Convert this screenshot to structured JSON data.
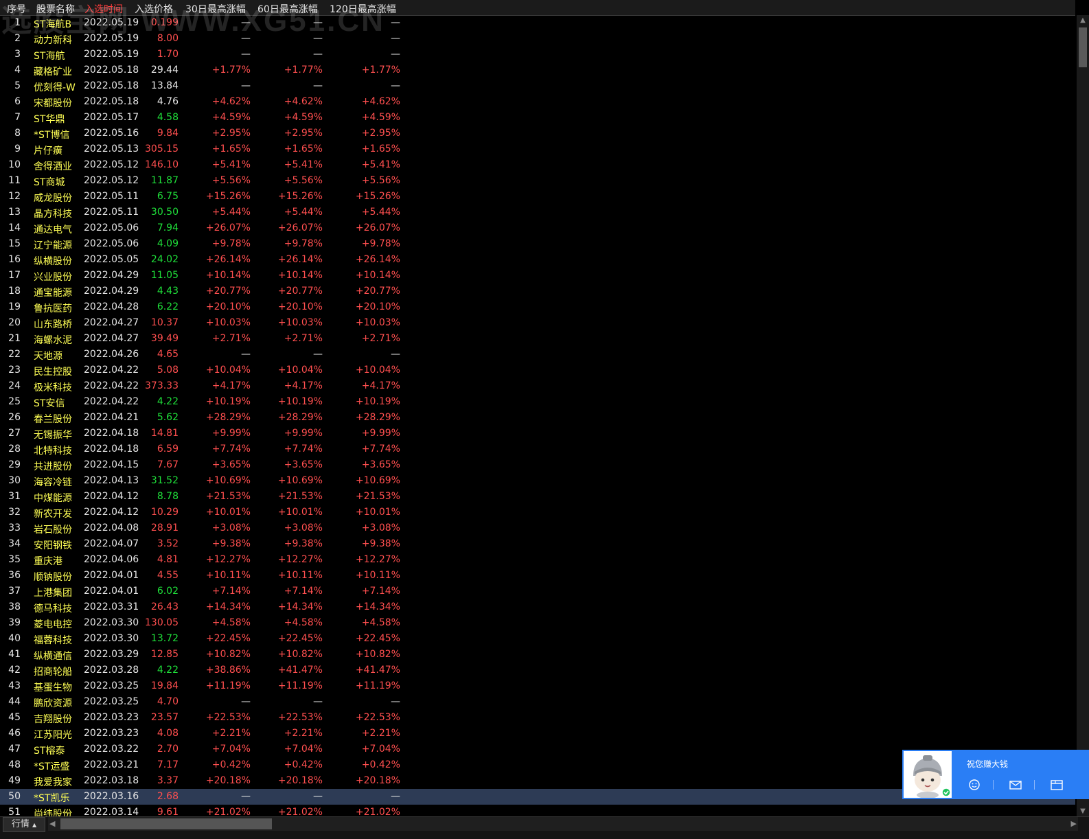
{
  "header": {
    "columns": [
      "序号",
      "股票名称",
      "入选时间",
      "入选价格",
      "30日最高涨幅",
      "60日最高涨幅",
      "120日最高涨幅"
    ],
    "active_column": "入选时间"
  },
  "watermark": "选股宝网 WWW.XG51.CN",
  "colors": {
    "up": "#ff4f4f",
    "down": "#1fe03a",
    "flat": "#e8e8e8",
    "name": "#ffff55",
    "selected_row": "#2d3b55",
    "popup": "#2a7ef5"
  },
  "rows": [
    {
      "idx": "1",
      "name": "ST海航B",
      "date": "2022.05.19",
      "price": "0.199",
      "pc": "red",
      "g30": "—",
      "g60": "—",
      "g120": "—"
    },
    {
      "idx": "2",
      "name": "动力新科",
      "date": "2022.05.19",
      "price": "8.00",
      "pc": "red",
      "g30": "—",
      "g60": "—",
      "g120": "—"
    },
    {
      "idx": "3",
      "name": "ST海航",
      "date": "2022.05.19",
      "price": "1.70",
      "pc": "red",
      "g30": "—",
      "g60": "—",
      "g120": "—"
    },
    {
      "idx": "4",
      "name": "藏格矿业",
      "date": "2022.05.18",
      "price": "29.44",
      "pc": "white",
      "g30": "+1.77%",
      "g60": "+1.77%",
      "g120": "+1.77%"
    },
    {
      "idx": "5",
      "name": "优刻得-W",
      "date": "2022.05.18",
      "price": "13.84",
      "pc": "white",
      "g30": "—",
      "g60": "—",
      "g120": "—"
    },
    {
      "idx": "6",
      "name": "宋都股份",
      "date": "2022.05.18",
      "price": "4.76",
      "pc": "white",
      "g30": "+4.62%",
      "g60": "+4.62%",
      "g120": "+4.62%"
    },
    {
      "idx": "7",
      "name": "ST华鼎",
      "date": "2022.05.17",
      "price": "4.58",
      "pc": "green",
      "g30": "+4.59%",
      "g60": "+4.59%",
      "g120": "+4.59%"
    },
    {
      "idx": "8",
      "name": "*ST博信",
      "date": "2022.05.16",
      "price": "9.84",
      "pc": "red",
      "g30": "+2.95%",
      "g60": "+2.95%",
      "g120": "+2.95%"
    },
    {
      "idx": "9",
      "name": "片仔癀",
      "date": "2022.05.13",
      "price": "305.15",
      "pc": "red",
      "g30": "+1.65%",
      "g60": "+1.65%",
      "g120": "+1.65%"
    },
    {
      "idx": "10",
      "name": "舍得酒业",
      "date": "2022.05.12",
      "price": "146.10",
      "pc": "red",
      "g30": "+5.41%",
      "g60": "+5.41%",
      "g120": "+5.41%"
    },
    {
      "idx": "11",
      "name": "ST商城",
      "date": "2022.05.12",
      "price": "11.87",
      "pc": "green",
      "g30": "+5.56%",
      "g60": "+5.56%",
      "g120": "+5.56%"
    },
    {
      "idx": "12",
      "name": "威龙股份",
      "date": "2022.05.11",
      "price": "6.75",
      "pc": "green",
      "g30": "+15.26%",
      "g60": "+15.26%",
      "g120": "+15.26%"
    },
    {
      "idx": "13",
      "name": "晶方科技",
      "date": "2022.05.11",
      "price": "30.50",
      "pc": "green",
      "g30": "+5.44%",
      "g60": "+5.44%",
      "g120": "+5.44%"
    },
    {
      "idx": "14",
      "name": "通达电气",
      "date": "2022.05.06",
      "price": "7.94",
      "pc": "green",
      "g30": "+26.07%",
      "g60": "+26.07%",
      "g120": "+26.07%"
    },
    {
      "idx": "15",
      "name": "辽宁能源",
      "date": "2022.05.06",
      "price": "4.09",
      "pc": "green",
      "g30": "+9.78%",
      "g60": "+9.78%",
      "g120": "+9.78%"
    },
    {
      "idx": "16",
      "name": "纵横股份",
      "date": "2022.05.05",
      "price": "24.02",
      "pc": "green",
      "g30": "+26.14%",
      "g60": "+26.14%",
      "g120": "+26.14%"
    },
    {
      "idx": "17",
      "name": "兴业股份",
      "date": "2022.04.29",
      "price": "11.05",
      "pc": "green",
      "g30": "+10.14%",
      "g60": "+10.14%",
      "g120": "+10.14%"
    },
    {
      "idx": "18",
      "name": "通宝能源",
      "date": "2022.04.29",
      "price": "4.43",
      "pc": "green",
      "g30": "+20.77%",
      "g60": "+20.77%",
      "g120": "+20.77%"
    },
    {
      "idx": "19",
      "name": "鲁抗医药",
      "date": "2022.04.28",
      "price": "6.22",
      "pc": "green",
      "g30": "+20.10%",
      "g60": "+20.10%",
      "g120": "+20.10%"
    },
    {
      "idx": "20",
      "name": "山东路桥",
      "date": "2022.04.27",
      "price": "10.37",
      "pc": "red",
      "g30": "+10.03%",
      "g60": "+10.03%",
      "g120": "+10.03%"
    },
    {
      "idx": "21",
      "name": "海螺水泥",
      "date": "2022.04.27",
      "price": "39.49",
      "pc": "red",
      "g30": "+2.71%",
      "g60": "+2.71%",
      "g120": "+2.71%"
    },
    {
      "idx": "22",
      "name": "天地源",
      "date": "2022.04.26",
      "price": "4.65",
      "pc": "red",
      "g30": "—",
      "g60": "—",
      "g120": "—"
    },
    {
      "idx": "23",
      "name": "民生控股",
      "date": "2022.04.22",
      "price": "5.08",
      "pc": "red",
      "g30": "+10.04%",
      "g60": "+10.04%",
      "g120": "+10.04%"
    },
    {
      "idx": "24",
      "name": "极米科技",
      "date": "2022.04.22",
      "price": "373.33",
      "pc": "red",
      "g30": "+4.17%",
      "g60": "+4.17%",
      "g120": "+4.17%"
    },
    {
      "idx": "25",
      "name": "ST安信",
      "date": "2022.04.22",
      "price": "4.22",
      "pc": "green",
      "g30": "+10.19%",
      "g60": "+10.19%",
      "g120": "+10.19%"
    },
    {
      "idx": "26",
      "name": "春兰股份",
      "date": "2022.04.21",
      "price": "5.62",
      "pc": "green",
      "g30": "+28.29%",
      "g60": "+28.29%",
      "g120": "+28.29%"
    },
    {
      "idx": "27",
      "name": "无锡振华",
      "date": "2022.04.18",
      "price": "14.81",
      "pc": "red",
      "g30": "+9.99%",
      "g60": "+9.99%",
      "g120": "+9.99%"
    },
    {
      "idx": "28",
      "name": "北特科技",
      "date": "2022.04.18",
      "price": "6.59",
      "pc": "red",
      "g30": "+7.74%",
      "g60": "+7.74%",
      "g120": "+7.74%"
    },
    {
      "idx": "29",
      "name": "共进股份",
      "date": "2022.04.15",
      "price": "7.67",
      "pc": "red",
      "g30": "+3.65%",
      "g60": "+3.65%",
      "g120": "+3.65%"
    },
    {
      "idx": "30",
      "name": "海容冷链",
      "date": "2022.04.13",
      "price": "31.52",
      "pc": "green",
      "g30": "+10.69%",
      "g60": "+10.69%",
      "g120": "+10.69%"
    },
    {
      "idx": "31",
      "name": "中煤能源",
      "date": "2022.04.12",
      "price": "8.78",
      "pc": "green",
      "g30": "+21.53%",
      "g60": "+21.53%",
      "g120": "+21.53%"
    },
    {
      "idx": "32",
      "name": "新农开发",
      "date": "2022.04.12",
      "price": "10.29",
      "pc": "red",
      "g30": "+10.01%",
      "g60": "+10.01%",
      "g120": "+10.01%"
    },
    {
      "idx": "33",
      "name": "岩石股份",
      "date": "2022.04.08",
      "price": "28.91",
      "pc": "red",
      "g30": "+3.08%",
      "g60": "+3.08%",
      "g120": "+3.08%"
    },
    {
      "idx": "34",
      "name": "安阳钢铁",
      "date": "2022.04.07",
      "price": "3.52",
      "pc": "red",
      "g30": "+9.38%",
      "g60": "+9.38%",
      "g120": "+9.38%"
    },
    {
      "idx": "35",
      "name": "重庆港",
      "date": "2022.04.06",
      "price": "4.81",
      "pc": "red",
      "g30": "+12.27%",
      "g60": "+12.27%",
      "g120": "+12.27%"
    },
    {
      "idx": "36",
      "name": "顺钠股份",
      "date": "2022.04.01",
      "price": "4.55",
      "pc": "red",
      "g30": "+10.11%",
      "g60": "+10.11%",
      "g120": "+10.11%"
    },
    {
      "idx": "37",
      "name": "上港集团",
      "date": "2022.04.01",
      "price": "6.02",
      "pc": "green",
      "g30": "+7.14%",
      "g60": "+7.14%",
      "g120": "+7.14%"
    },
    {
      "idx": "38",
      "name": "德马科技",
      "date": "2022.03.31",
      "price": "26.43",
      "pc": "red",
      "g30": "+14.34%",
      "g60": "+14.34%",
      "g120": "+14.34%"
    },
    {
      "idx": "39",
      "name": "菱电电控",
      "date": "2022.03.30",
      "price": "130.05",
      "pc": "red",
      "g30": "+4.58%",
      "g60": "+4.58%",
      "g120": "+4.58%"
    },
    {
      "idx": "40",
      "name": "福蓉科技",
      "date": "2022.03.30",
      "price": "13.72",
      "pc": "green",
      "g30": "+22.45%",
      "g60": "+22.45%",
      "g120": "+22.45%"
    },
    {
      "idx": "41",
      "name": "纵横通信",
      "date": "2022.03.29",
      "price": "12.85",
      "pc": "red",
      "g30": "+10.82%",
      "g60": "+10.82%",
      "g120": "+10.82%"
    },
    {
      "idx": "42",
      "name": "招商轮船",
      "date": "2022.03.28",
      "price": "4.22",
      "pc": "green",
      "g30": "+38.86%",
      "g60": "+41.47%",
      "g120": "+41.47%"
    },
    {
      "idx": "43",
      "name": "基蛋生物",
      "date": "2022.03.25",
      "price": "19.84",
      "pc": "red",
      "g30": "+11.19%",
      "g60": "+11.19%",
      "g120": "+11.19%"
    },
    {
      "idx": "44",
      "name": "鹏欣资源",
      "date": "2022.03.25",
      "price": "4.70",
      "pc": "red",
      "g30": "—",
      "g60": "—",
      "g120": "—"
    },
    {
      "idx": "45",
      "name": "吉翔股份",
      "date": "2022.03.23",
      "price": "23.57",
      "pc": "red",
      "g30": "+22.53%",
      "g60": "+22.53%",
      "g120": "+22.53%"
    },
    {
      "idx": "46",
      "name": "江苏阳光",
      "date": "2022.03.23",
      "price": "4.08",
      "pc": "red",
      "g30": "+2.21%",
      "g60": "+2.21%",
      "g120": "+2.21%"
    },
    {
      "idx": "47",
      "name": "ST榕泰",
      "date": "2022.03.22",
      "price": "2.70",
      "pc": "red",
      "g30": "+7.04%",
      "g60": "+7.04%",
      "g120": "+7.04%"
    },
    {
      "idx": "48",
      "name": "*ST运盛",
      "date": "2022.03.21",
      "price": "7.17",
      "pc": "red",
      "g30": "+0.42%",
      "g60": "+0.42%",
      "g120": "+0.42%"
    },
    {
      "idx": "49",
      "name": "我爱我家",
      "date": "2022.03.18",
      "price": "3.37",
      "pc": "red",
      "g30": "+20.18%",
      "g60": "+20.18%",
      "g120": "+20.18%"
    },
    {
      "idx": "50",
      "name": "*ST凯乐",
      "date": "2022.03.16",
      "price": "2.68",
      "pc": "red",
      "g30": "—",
      "g60": "—",
      "g120": "—",
      "selected": true
    },
    {
      "idx": "51",
      "name": "尚纬股份",
      "date": "2022.03.14",
      "price": "9.61",
      "pc": "red",
      "g30": "+21.02%",
      "g60": "+21.02%",
      "g120": "+21.02%"
    }
  ],
  "bottom": {
    "tab_label": "行情",
    "tab_arrow": "▲"
  },
  "popup": {
    "greeting": "祝您赚大钱",
    "icons": [
      "smile-icon",
      "mail-icon",
      "calendar-icon"
    ]
  }
}
